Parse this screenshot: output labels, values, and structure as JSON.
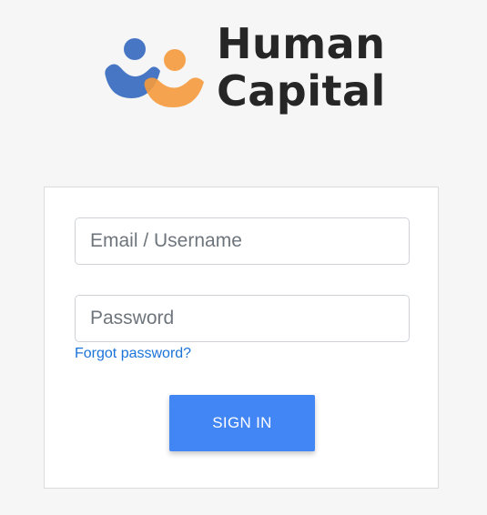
{
  "brand": {
    "line1": "Human",
    "line2": "Capital",
    "colors": {
      "blue": "#3d6fc1",
      "orange": "#f59a3c",
      "text": "#262626"
    }
  },
  "login": {
    "email_placeholder": "Email / Username",
    "password_placeholder": "Password",
    "forgot_label": "Forgot password?",
    "signin_label": "SIGN IN",
    "accent": "#4285f4",
    "link_color": "#1a73d9"
  }
}
